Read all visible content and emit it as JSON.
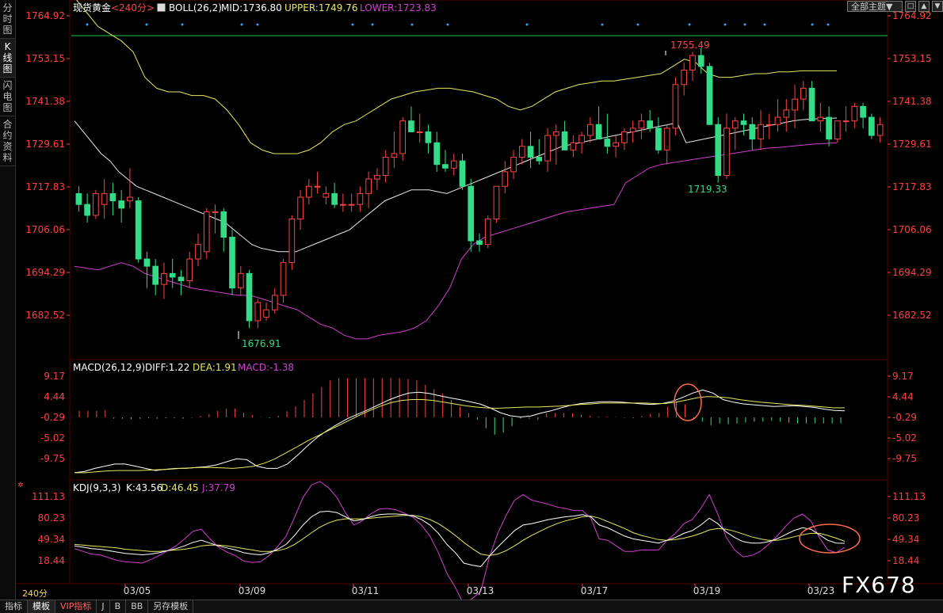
{
  "sidebar": {
    "tabs": [
      "分时图",
      "K线图",
      "闪电图",
      "合约资料"
    ],
    "active": 1
  },
  "toolbar": {
    "theme_label": "全部主题▼",
    "buttons": [
      "□",
      "▲",
      "▼"
    ]
  },
  "main_panel": {
    "symbol": "现货黄金",
    "period_tag": "<240分>",
    "indicator": "BOLL(26,2)",
    "mid": "MID:1736.80",
    "upper": "UPPER:1749.76",
    "lower": "LOWER:1723.83",
    "y_ticks": [
      "1764.92",
      "1753.15",
      "1741.38",
      "1729.61",
      "1717.83",
      "1706.06",
      "1694.29",
      "1682.52"
    ],
    "high_label": "1755.49",
    "low_label_1": "1676.91",
    "low_label_2": "1719.33"
  },
  "macd_panel": {
    "title": "MACD(26,12,9)",
    "diff": "DIFF:1.22",
    "dea": "DEA:1.91",
    "macd": "MACD:-1.38",
    "y_ticks": [
      "9.17",
      "4.44",
      "-0.29",
      "-5.02",
      "-9.75"
    ]
  },
  "kdj_panel": {
    "title": "KDJ(9,3,3)",
    "k": "K:43.56",
    "d": "D:46.45",
    "j": "J:37.79",
    "y_ticks": [
      "111.13",
      "80.23",
      "49.34",
      "18.44"
    ]
  },
  "x_axis": [
    "03/05",
    "03/09",
    "03/11",
    "03/13",
    "03/17",
    "03/19",
    "03/23"
  ],
  "period_label": "240分",
  "bottom_tabs": [
    "指标",
    "模板",
    "VIP指标",
    "J",
    "B",
    "BB",
    "另存模板"
  ],
  "watermark": "FX678",
  "colors": {
    "up": "#ff4444",
    "down": "#33dd88",
    "mid": "#e8e8e8",
    "upper": "#e8e860",
    "lower": "#d040d0",
    "axis_red": "#ff4040",
    "grid": "#3a0000"
  },
  "chart_data": {
    "type": "candlestick",
    "candles": [
      [
        1716,
        1718,
        1711,
        1713
      ],
      [
        1713,
        1716,
        1708,
        1710
      ],
      [
        1710,
        1717,
        1709,
        1716
      ],
      [
        1713,
        1720,
        1709,
        1716
      ],
      [
        1716,
        1719,
        1710,
        1714
      ],
      [
        1714,
        1717,
        1708,
        1712
      ],
      [
        1714,
        1723,
        1712,
        1715
      ],
      [
        1714,
        1715,
        1697,
        1698
      ],
      [
        1698,
        1700,
        1690,
        1696
      ],
      [
        1696,
        1698,
        1688,
        1691
      ],
      [
        1691,
        1697,
        1687,
        1694
      ],
      [
        1694,
        1698,
        1690,
        1693
      ],
      [
        1693,
        1695,
        1688,
        1692
      ],
      [
        1692,
        1700,
        1690,
        1698
      ],
      [
        1698,
        1705,
        1696,
        1702
      ],
      [
        1700,
        1712,
        1698,
        1711
      ],
      [
        1711,
        1713,
        1705,
        1711
      ],
      [
        1711,
        1712,
        1700,
        1704
      ],
      [
        1704,
        1706,
        1688,
        1690
      ],
      [
        1690,
        1696,
        1688,
        1694
      ],
      [
        1694,
        1695,
        1679,
        1681
      ],
      [
        1681,
        1687,
        1679,
        1686
      ],
      [
        1682,
        1686,
        1681,
        1684
      ],
      [
        1684,
        1690,
        1683,
        1688
      ],
      [
        1688,
        1698,
        1686,
        1697
      ],
      [
        1697,
        1710,
        1695,
        1709
      ],
      [
        1709,
        1717,
        1706,
        1715
      ],
      [
        1715,
        1720,
        1713,
        1718
      ],
      [
        1718,
        1722,
        1716,
        1718
      ],
      [
        1715,
        1718,
        1713,
        1716
      ],
      [
        1716,
        1719,
        1712,
        1713
      ],
      [
        1713,
        1716,
        1711,
        1713
      ],
      [
        1713,
        1716,
        1711,
        1713
      ],
      [
        1713,
        1718,
        1711,
        1716
      ],
      [
        1716,
        1722,
        1712,
        1720
      ],
      [
        1720,
        1723,
        1717,
        1721
      ],
      [
        1721,
        1728,
        1719,
        1726
      ],
      [
        1726,
        1733,
        1723,
        1727
      ],
      [
        1727,
        1737,
        1725,
        1736
      ],
      [
        1736,
        1740,
        1733,
        1733
      ],
      [
        1733,
        1738,
        1730,
        1733
      ],
      [
        1733,
        1735,
        1727,
        1730
      ],
      [
        1730,
        1733,
        1722,
        1724
      ],
      [
        1724,
        1728,
        1722,
        1723
      ],
      [
        1723,
        1727,
        1721,
        1725
      ],
      [
        1725,
        1727,
        1717,
        1718
      ],
      [
        1718,
        1720,
        1700,
        1703
      ],
      [
        1703,
        1705,
        1700,
        1702
      ],
      [
        1702,
        1710,
        1701,
        1709
      ],
      [
        1709,
        1718,
        1708,
        1718
      ],
      [
        1718,
        1725,
        1716,
        1722
      ],
      [
        1722,
        1728,
        1720,
        1726
      ],
      [
        1726,
        1731,
        1724,
        1729
      ],
      [
        1729,
        1733,
        1723,
        1726
      ],
      [
        1726,
        1731,
        1724,
        1725
      ],
      [
        1725,
        1734,
        1722,
        1732
      ],
      [
        1732,
        1735,
        1724,
        1733
      ],
      [
        1733,
        1736,
        1728,
        1728
      ],
      [
        1728,
        1732,
        1726,
        1730
      ],
      [
        1730,
        1733,
        1727,
        1732
      ],
      [
        1732,
        1737,
        1730,
        1735
      ],
      [
        1735,
        1740,
        1731,
        1731
      ],
      [
        1731,
        1738,
        1727,
        1729
      ],
      [
        1729,
        1732,
        1726,
        1730
      ],
      [
        1730,
        1734,
        1728,
        1733
      ],
      [
        1733,
        1736,
        1730,
        1734
      ],
      [
        1734,
        1738,
        1731,
        1736
      ],
      [
        1736,
        1739,
        1733,
        1734
      ],
      [
        1734,
        1737,
        1727,
        1728
      ],
      [
        1728,
        1735,
        1724,
        1734
      ],
      [
        1734,
        1748,
        1732,
        1746
      ],
      [
        1746,
        1752,
        1743,
        1750
      ],
      [
        1750,
        1755,
        1747,
        1754
      ],
      [
        1754,
        1756,
        1749,
        1751
      ],
      [
        1751,
        1752,
        1735,
        1735
      ],
      [
        1735,
        1737,
        1719,
        1721
      ],
      [
        1721,
        1738,
        1720,
        1734
      ],
      [
        1734,
        1737,
        1728,
        1736
      ],
      [
        1736,
        1738,
        1732,
        1735
      ],
      [
        1735,
        1737,
        1728,
        1731
      ],
      [
        1731,
        1739,
        1728,
        1735
      ],
      [
        1735,
        1738,
        1731,
        1735
      ],
      [
        1735,
        1742,
        1733,
        1737
      ],
      [
        1737,
        1742,
        1733,
        1739
      ],
      [
        1739,
        1746,
        1734,
        1742
      ],
      [
        1742,
        1747,
        1739,
        1745
      ],
      [
        1745,
        1747,
        1736,
        1736
      ],
      [
        1736,
        1741,
        1733,
        1737
      ],
      [
        1737,
        1740,
        1729,
        1731
      ],
      [
        1731,
        1736,
        1730,
        1736
      ],
      [
        1736,
        1740,
        1733,
        1736
      ],
      [
        1736,
        1741,
        1734,
        1740
      ],
      [
        1740,
        1741,
        1734,
        1737
      ],
      [
        1737,
        1738,
        1731,
        1732
      ],
      [
        1732,
        1737,
        1730,
        1735
      ]
    ],
    "mid": [
      1736,
      1733,
      1730,
      1727,
      1725,
      1722,
      1720,
      1718,
      1717,
      1716,
      1715,
      1714,
      1713,
      1712,
      1711,
      1710,
      1709,
      1708,
      1706,
      1704,
      1702,
      1701,
      1700.5,
      1700,
      1700,
      1700,
      1701,
      1702,
      1703,
      1704,
      1705,
      1706,
      1708,
      1710,
      1712,
      1714,
      1715,
      1716,
      1717,
      1717,
      1717,
      1716.5,
      1716,
      1717,
      1718,
      1719,
      1720,
      1721,
      1722,
      1723,
      1724,
      1725,
      1726,
      1727,
      1728,
      1729,
      1729.5,
      1730,
      1730.5,
      1731,
      1731.5,
      1732,
      1732.5,
      1733,
      1733.5,
      1734,
      1734.5,
      1735,
      1735.5,
      1730,
      1730.5,
      1731,
      1731.5,
      1732,
      1732.5,
      1733,
      1733.5,
      1734,
      1734.5,
      1735,
      1735.5,
      1736,
      1736.3,
      1736.5,
      1736.6,
      1736.7,
      1736.8
    ],
    "upper": [
      1770,
      1766,
      1762,
      1760,
      1758,
      1755,
      1748,
      1745,
      1744,
      1744,
      1743,
      1743,
      1742,
      1739,
      1735,
      1730,
      1728,
      1727,
      1727,
      1727,
      1728,
      1730,
      1733,
      1735,
      1736,
      1738,
      1740,
      1742,
      1743,
      1744,
      1744.5,
      1745,
      1745,
      1744.5,
      1744,
      1743,
      1742,
      1740,
      1739,
      1740,
      1742,
      1744,
      1745,
      1746,
      1746.5,
      1747,
      1747,
      1747.5,
      1748,
      1748.5,
      1749,
      1751,
      1753,
      1752,
      1749,
      1748,
      1748,
      1748.5,
      1749,
      1749,
      1749.5,
      1749.5,
      1749.8,
      1749.8,
      1749.8,
      1749.8
    ],
    "lower": [
      1696,
      1695.5,
      1695,
      1696,
      1697,
      1696,
      1694,
      1693,
      1692,
      1691,
      1690,
      1689.5,
      1689,
      1688.5,
      1688,
      1688,
      1687,
      1686,
      1685,
      1684,
      1682,
      1680,
      1679,
      1677,
      1676,
      1676,
      1677,
      1677.5,
      1678,
      1679,
      1681,
      1685,
      1690,
      1698,
      1702,
      1704,
      1705,
      1706,
      1707,
      1708,
      1709,
      1710,
      1711,
      1711.5,
      1712,
      1712.5,
      1713,
      1719,
      1721,
      1723,
      1724,
      1724.5,
      1725,
      1725.5,
      1726,
      1726.5,
      1727,
      1727.5,
      1728,
      1728.5,
      1728.7,
      1729,
      1729.3,
      1729.6,
      1729.8,
      1730
    ],
    "macd_hist": [
      1.5,
      1.5,
      1.5,
      1.6,
      -0.3,
      -0.3,
      -0.4,
      -0.3,
      -0.2,
      -0.3,
      -0.2,
      -0.2,
      -0.3,
      -0.1,
      0.3,
      0.8,
      1.5,
      2.0,
      2.0,
      1.0,
      0.5,
      0.1,
      -0.2,
      0.4,
      1.4,
      2.5,
      4.0,
      5.5,
      7.0,
      8.5,
      9.0,
      9.0,
      9.0,
      9.0,
      9.0,
      9.0,
      9.0,
      9.0,
      8.8,
      8.5,
      7.5,
      6.5,
      5.5,
      4.0,
      2.5,
      1.0,
      -0.5,
      -2.5,
      -4.0,
      -3.5,
      -2.0,
      -0.3,
      -0.3,
      -0.5,
      1.0,
      1.0,
      1.0,
      0.9,
      0.6,
      0.4,
      0.2,
      0.2,
      0.1,
      -0.1,
      -0.2,
      0.3,
      0.8,
      1.0,
      2.5,
      3.5,
      3.0,
      -0.5,
      -1.0,
      -1.8,
      -1.4,
      -1.6,
      -1.4,
      -1.2,
      -1.0,
      -1.0,
      -0.8,
      -1.0,
      -1.2,
      -1.4,
      -1.4,
      -1.4,
      -1.4,
      -1.4,
      -1.38
    ],
    "diff": [
      -13,
      -12.7,
      -12,
      -11.5,
      -11,
      -11,
      -11.5,
      -12,
      -12.5,
      -12.2,
      -12,
      -12,
      -11.8,
      -11.6,
      -11.2,
      -10.5,
      -9.8,
      -10,
      -11.5,
      -12,
      -12,
      -11,
      -9,
      -6.8,
      -4.8,
      -3.2,
      -1.8,
      -0.5,
      0.5,
      1.5,
      2.6,
      3.7,
      4.6,
      5.3,
      5.5,
      5.2,
      4.7,
      4.2,
      3.8,
      3.3,
      2.8,
      1.9,
      0.8,
      0.1,
      -0.2,
      0.0,
      0.7,
      1.2,
      1.9,
      2.5,
      2.9,
      3.1,
      3.3,
      3.3,
      3.2,
      3.0,
      2.8,
      2.7,
      2.9,
      3.4,
      4.3,
      5.3,
      6.0,
      5.3,
      3.8,
      3.2,
      2.8,
      2.6,
      2.4,
      2.2,
      2.3,
      2.4,
      2.2,
      2.0,
      1.6,
      1.3,
      1.22
    ],
    "dea": [
      -13,
      -13,
      -12.8,
      -12.6,
      -12.5,
      -12.5,
      -12.5,
      -12.4,
      -12.3,
      -12.2,
      -12,
      -11.9,
      -11.8,
      -11.8,
      -11.9,
      -12,
      -11.8,
      -11.5,
      -10.8,
      -9.8,
      -8.5,
      -7.2,
      -5.8,
      -4.6,
      -3.4,
      -2.2,
      -1.0,
      0.2,
      1.3,
      2.3,
      3.1,
      3.6,
      3.8,
      3.8,
      3.6,
      3.2,
      2.8,
      2.4,
      2.1,
      1.9,
      1.8,
      1.9,
      2.0,
      2.1,
      2.1,
      2.2,
      2.3,
      2.5,
      2.7,
      2.8,
      3.0,
      3.0,
      3.0,
      3.0,
      3.0,
      2.9,
      2.9,
      3.2,
      3.7,
      4.2,
      4.5,
      4.4,
      4.2,
      3.8,
      3.5,
      3.2,
      3.0,
      2.8,
      2.6,
      2.5,
      2.3,
      2.1,
      1.9,
      1.91
    ],
    "kdj_k": [
      40,
      38,
      36,
      35,
      33,
      31,
      29,
      28,
      27,
      28,
      30,
      33,
      36,
      40,
      45,
      48,
      44,
      40,
      37,
      34,
      30,
      28,
      27,
      30,
      35,
      42,
      55,
      70,
      82,
      89,
      90,
      88,
      82,
      76,
      78,
      82,
      85,
      86,
      86,
      85,
      83,
      78,
      70,
      58,
      42,
      30,
      15,
      12,
      10,
      25,
      38,
      50,
      62,
      70,
      72,
      75,
      78,
      80,
      82,
      83,
      85,
      82,
      70,
      66,
      60,
      54,
      50,
      48,
      46,
      44,
      48,
      52,
      58,
      62,
      70,
      80,
      72,
      60,
      52,
      46,
      44,
      44,
      46,
      50,
      56,
      62,
      66,
      64,
      56,
      48,
      44,
      43.56
    ],
    "kdj_d": [
      42,
      41,
      40,
      39,
      38,
      37,
      35,
      34,
      33,
      32,
      32,
      33,
      34,
      35,
      37,
      40,
      41,
      41,
      40,
      38,
      36,
      34,
      32,
      32,
      33,
      36,
      42,
      50,
      59,
      67,
      73,
      77,
      79,
      79,
      79,
      80,
      81,
      82,
      83,
      84,
      84,
      82,
      78,
      72,
      64,
      55,
      45,
      36,
      28,
      26,
      28,
      33,
      40,
      48,
      55,
      61,
      67,
      72,
      76,
      79,
      82,
      83,
      80,
      75,
      70,
      65,
      59,
      55,
      52,
      49,
      48,
      49,
      51,
      54,
      58,
      63,
      65,
      64,
      61,
      57,
      53,
      50,
      48,
      48,
      50,
      53,
      56,
      58,
      58,
      55,
      51,
      46.45
    ],
    "kdj_j": [
      36,
      32,
      28,
      27,
      23,
      19,
      17,
      16,
      15,
      20,
      26,
      33,
      40,
      50,
      61,
      64,
      50,
      38,
      31,
      26,
      18,
      16,
      17,
      26,
      39,
      54,
      81,
      110,
      128,
      133,
      124,
      110,
      88,
      70,
      76,
      86,
      93,
      94,
      92,
      87,
      81,
      70,
      54,
      30,
      0,
      -20,
      -45,
      -36,
      -26,
      23,
      58,
      84,
      106,
      114,
      106,
      103,
      100,
      96,
      94,
      91,
      91,
      80,
      50,
      48,
      40,
      32,
      32,
      34,
      34,
      34,
      48,
      58,
      72,
      78,
      94,
      114,
      86,
      52,
      34,
      24,
      26,
      32,
      42,
      54,
      68,
      80,
      86,
      76,
      52,
      34,
      30,
      37.79
    ]
  }
}
